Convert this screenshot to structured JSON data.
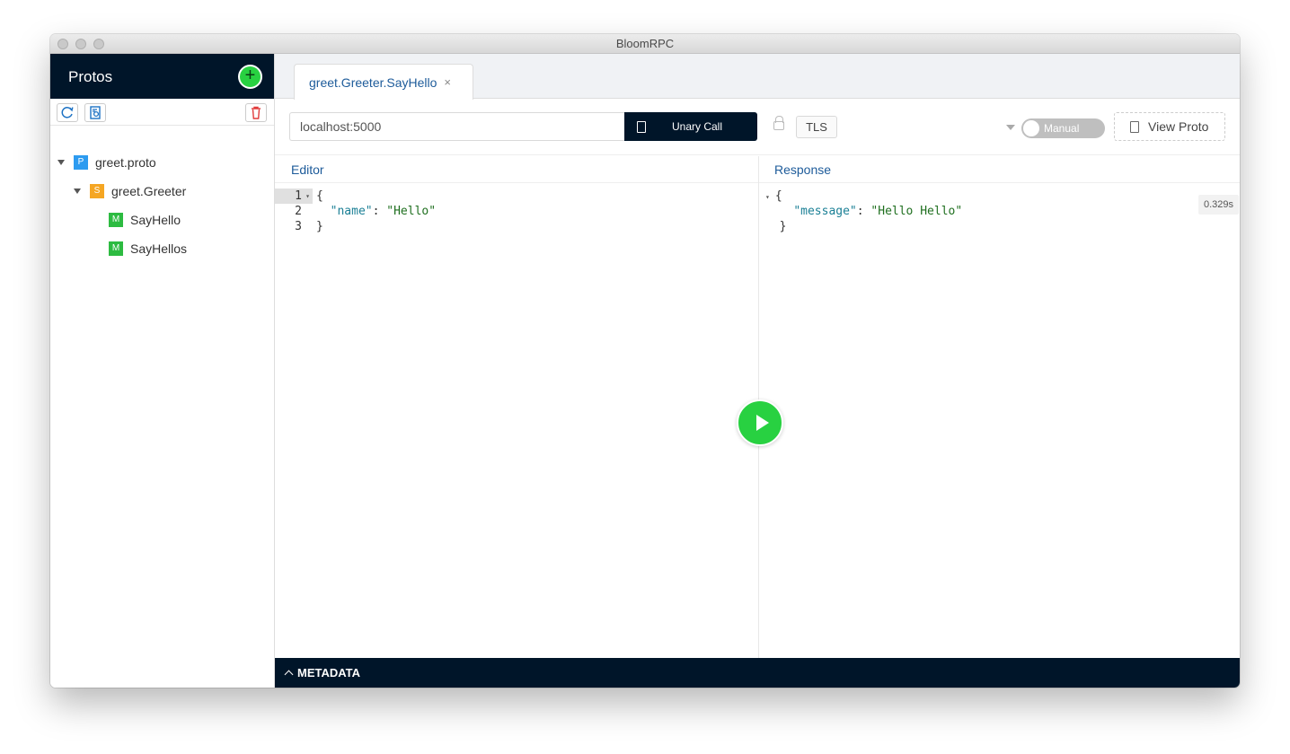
{
  "window": {
    "title": "BloomRPC"
  },
  "sidebar": {
    "title": "Protos",
    "add_symbol": "+",
    "tree": [
      {
        "tag": "P",
        "label": "greet.proto",
        "tag_color": "#2d9bf0"
      },
      {
        "tag": "S",
        "label": "greet.Greeter",
        "tag_color": "#f5a623"
      },
      {
        "tag": "M",
        "label": "SayHello",
        "tag_color": "#2dbb41"
      },
      {
        "tag": "M",
        "label": "SayHellos",
        "tag_color": "#2dbb41"
      }
    ]
  },
  "tab": {
    "label": "greet.Greeter.SayHello",
    "close": "×"
  },
  "controls": {
    "address": "localhost:5000",
    "call_type": "Unary Call",
    "tls": "TLS",
    "mode": "Manual",
    "view_proto": "View Proto"
  },
  "editor": {
    "heading": "Editor",
    "line_numbers": [
      "1",
      "2",
      "3"
    ],
    "open_brace": "{",
    "key": "\"name\"",
    "colon": ": ",
    "value": "\"Hello\"",
    "close_brace": "}"
  },
  "response": {
    "heading": "Response",
    "open_brace": "{",
    "key": "\"message\"",
    "colon": ": ",
    "value": "\"Hello Hello\"",
    "close_brace": "}",
    "time": "0.329s"
  },
  "footer": {
    "metadata_label": "METADATA"
  },
  "colors": {
    "dark_nav": "#001529",
    "accent_green": "#28d141",
    "link_blue": "#1d5b9a"
  }
}
